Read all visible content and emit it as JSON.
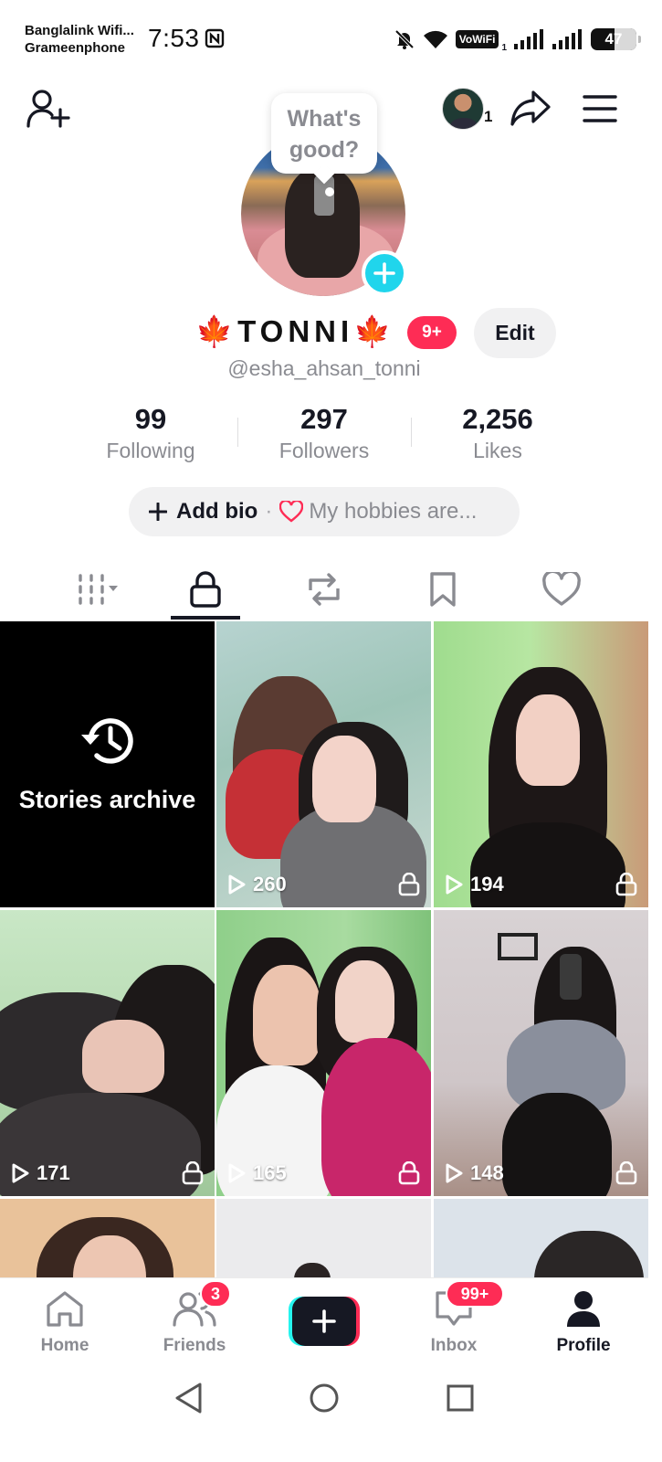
{
  "status_bar": {
    "carrier_line1": "Banglalink Wifi...",
    "carrier_line2": "Grameenphone",
    "time": "7:53",
    "vowifi_label": "VoWiFi",
    "vowifi_sub": "1",
    "battery_level": "47"
  },
  "top_nav": {
    "account_badge_count": "1"
  },
  "profile": {
    "avatar_prompt": "What's good?",
    "display_name": "🍁TONNI🍁",
    "notification_badge": "9+",
    "edit_label": "Edit",
    "username": "@esha_ahsan_tonni"
  },
  "stats": [
    {
      "value": "99",
      "label": "Following"
    },
    {
      "value": "297",
      "label": "Followers"
    },
    {
      "value": "2,256",
      "label": "Likes"
    }
  ],
  "bio": {
    "add_label": "Add bio",
    "separator": "·",
    "hint": "My hobbies are..."
  },
  "tabs": [
    {
      "icon": "grid-icon"
    },
    {
      "icon": "lock-icon",
      "active": true
    },
    {
      "icon": "repost-icon"
    },
    {
      "icon": "bookmark-icon"
    },
    {
      "icon": "heart-icon"
    }
  ],
  "grid": {
    "archive_label": "Stories archive",
    "videos": [
      {
        "plays": "260"
      },
      {
        "plays": "194"
      },
      {
        "plays": "171"
      },
      {
        "plays": "165"
      },
      {
        "plays": "148"
      }
    ]
  },
  "bottom_nav": {
    "home": "Home",
    "friends": "Friends",
    "friends_badge": "3",
    "inbox": "Inbox",
    "inbox_badge": "99+",
    "profile": "Profile"
  },
  "colors": {
    "accent": "#fe2c55",
    "cyan": "#20d5ec",
    "text": "#161823",
    "muted": "#8a8b91"
  }
}
